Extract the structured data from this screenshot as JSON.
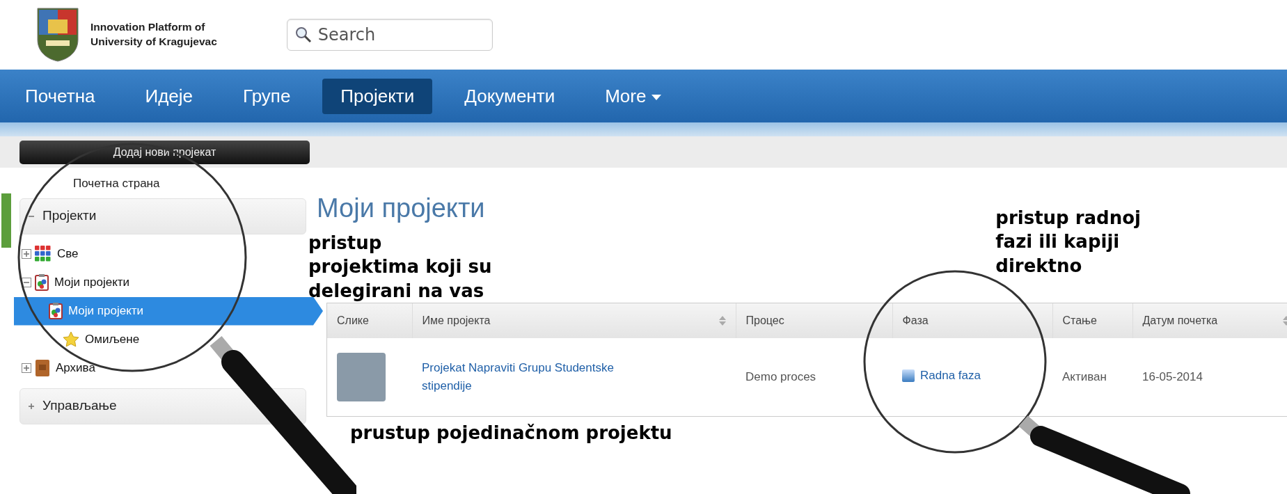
{
  "header": {
    "logo_text": [
      "Innovation Platform of",
      "University of Kragujevac"
    ],
    "search": {
      "placeholder": "Search"
    }
  },
  "nav": [
    {
      "label": "Почетна",
      "selected": false,
      "kind": "link"
    },
    {
      "label": "Идеје",
      "selected": false,
      "kind": "link"
    },
    {
      "label": "Групе",
      "selected": false,
      "kind": "link"
    },
    {
      "label": "Пројекти",
      "selected": true,
      "kind": "link"
    },
    {
      "label": "Документи",
      "selected": false,
      "kind": "link"
    },
    {
      "label": "More",
      "selected": false,
      "kind": "dropdown"
    }
  ],
  "sidebar": {
    "add_button": "Додај нови пројекат",
    "home_link": "Почетна страна",
    "sections": [
      {
        "label": "Пројекти",
        "expanded": true,
        "tree": [
          {
            "label": "Све",
            "kind": "grid",
            "expanded": false,
            "selected": false
          },
          {
            "label": "Моји пројекти",
            "kind": "clipboard",
            "expanded": true,
            "selected": false,
            "children": [
              {
                "label": "Моји пројекти",
                "kind": "clipboard",
                "selected": true
              },
              {
                "label": "Омиљене",
                "kind": "star",
                "selected": false
              }
            ]
          },
          {
            "label": "Архива",
            "kind": "archive",
            "expanded": false,
            "selected": false
          }
        ]
      },
      {
        "label": "Управљање",
        "expanded": false
      }
    ]
  },
  "content": {
    "title": "Моји пројекти",
    "annotations": [
      {
        "text": "pristup\nprojektima koji su\ndelegirani na vas"
      },
      {
        "text": "pristup radnoj\nfazi ili kapiji\ndirektno"
      },
      {
        "text": "prustup pojedinačnom projektu"
      }
    ],
    "table": {
      "columns": [
        {
          "label": "Слике",
          "sortable": false
        },
        {
          "label": "Име пројекта",
          "sortable": true
        },
        {
          "label": "Процес",
          "sortable": false
        },
        {
          "label": "Фаза",
          "sortable": false
        },
        {
          "label": "Стање",
          "sortable": false
        },
        {
          "label": "Датум почетка",
          "sortable": true
        }
      ],
      "rows": [
        {
          "name": "Projekat Napraviti Grupu Studentske stipendije",
          "process": "Demo proces",
          "phase": "Radna faza",
          "status": "Активан",
          "date": "16-05-2014"
        }
      ]
    }
  }
}
